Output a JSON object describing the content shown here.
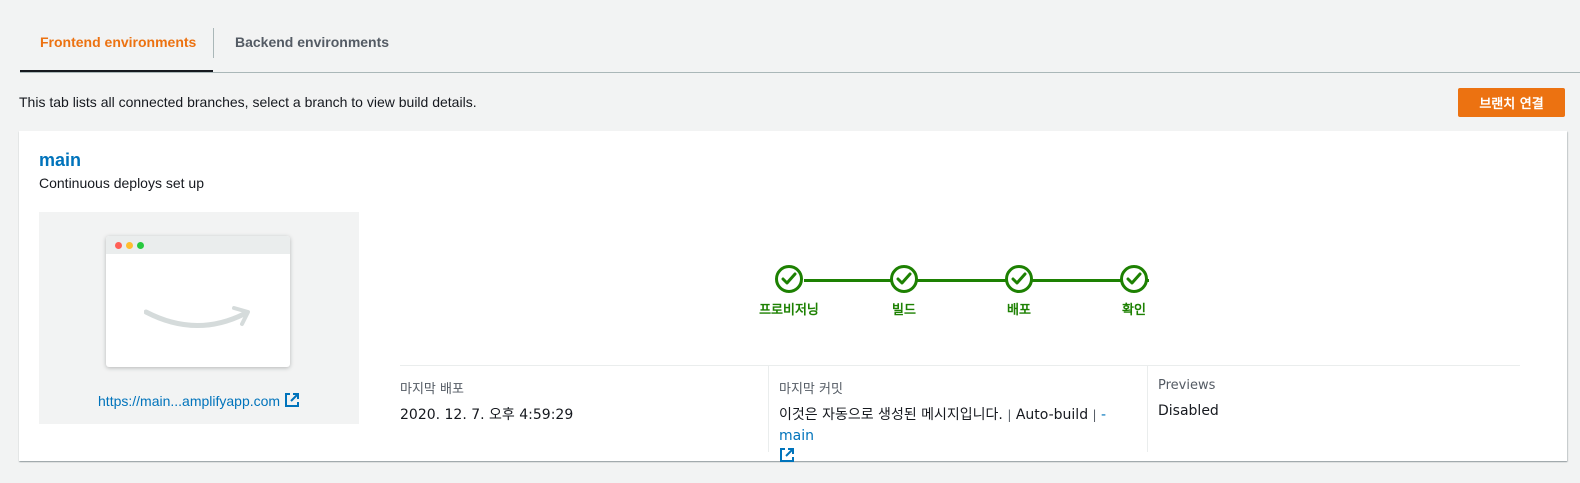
{
  "tabs": [
    {
      "label": "Frontend environments",
      "active": true
    },
    {
      "label": "Backend environments",
      "active": false
    }
  ],
  "description": "This tab lists all connected branches, select a branch to view build details.",
  "connect_button": "브랜치 연결",
  "branch": {
    "name": "main",
    "status": "Continuous deploys set up",
    "url": "https://main...amplifyapp.com",
    "url_icon": "external-link-icon"
  },
  "pipeline": {
    "steps": [
      {
        "label": "프로비저닝",
        "state": "success"
      },
      {
        "label": "빌드",
        "state": "success"
      },
      {
        "label": "배포",
        "state": "success"
      },
      {
        "label": "확인",
        "state": "success"
      }
    ]
  },
  "info": {
    "last_deploy": {
      "label": "마지막 배포",
      "value": "2020. 12. 7. 오후 4:59:29"
    },
    "last_commit": {
      "label": "마지막 커밋",
      "message": "이것은 자동으로 생성된 메시지입니다.",
      "separator": "|",
      "author": "Auto-build",
      "branch_link": "- main"
    },
    "previews": {
      "label": "Previews",
      "value": "Disabled"
    }
  },
  "colors": {
    "accent": "#ec7211",
    "link": "#0073bb",
    "success": "#1d8102"
  }
}
